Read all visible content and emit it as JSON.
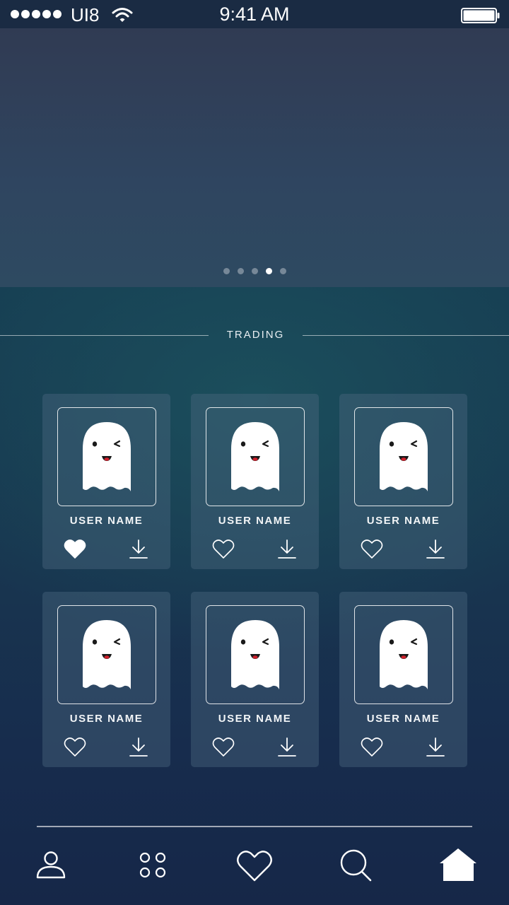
{
  "status_bar": {
    "carrier": "UI8",
    "time": "9:41 AM",
    "signal_icon": "signal-dots-icon",
    "wifi_icon": "wifi-icon",
    "battery_icon": "battery-icon"
  },
  "hero": {
    "pager": {
      "count": 5,
      "active_index": 3
    }
  },
  "section": {
    "title": "TRADING"
  },
  "cards": [
    {
      "user_name": "USER NAME",
      "liked": true
    },
    {
      "user_name": "USER NAME",
      "liked": false
    },
    {
      "user_name": "USER NAME",
      "liked": false
    },
    {
      "user_name": "USER NAME",
      "liked": false
    },
    {
      "user_name": "USER NAME",
      "liked": false
    },
    {
      "user_name": "USER NAME",
      "liked": false
    }
  ],
  "card_icons": {
    "avatar": "ghost-icon",
    "like": "heart-icon",
    "download": "download-icon"
  },
  "tab_bar": {
    "tabs": [
      {
        "icon": "profile-icon",
        "active": false
      },
      {
        "icon": "grid-icon",
        "active": false
      },
      {
        "icon": "heart-icon",
        "active": false
      },
      {
        "icon": "search-icon",
        "active": false
      },
      {
        "icon": "home-icon",
        "active": true
      }
    ]
  },
  "colors": {
    "accent_white": "#ffffff",
    "ghost_mouth": "#d0202c",
    "status_bar_bg": "#1a2b43",
    "card_bg": "#4c6880"
  }
}
